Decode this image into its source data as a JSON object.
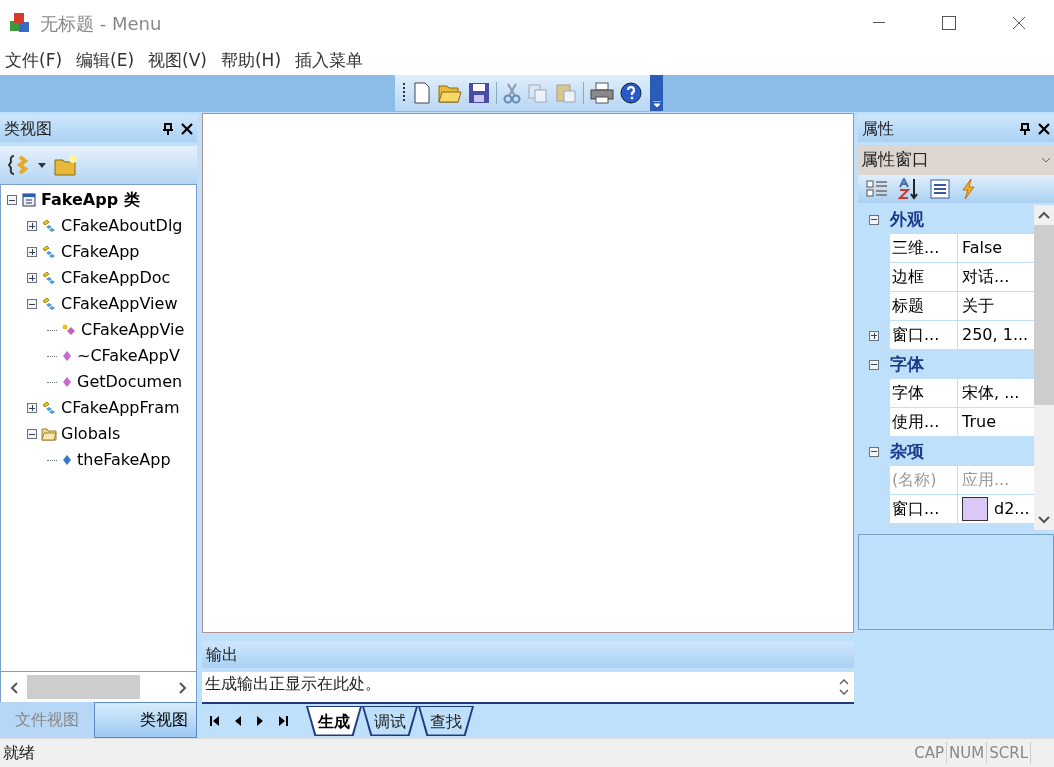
{
  "window": {
    "title": "无标题 - Menu"
  },
  "menu": [
    "文件(F)",
    "编辑(E)",
    "视图(V)",
    "帮助(H)",
    "插入菜单"
  ],
  "class_view": {
    "title": "类视图",
    "tree": [
      {
        "label": "FakeApp 类",
        "kind": "project",
        "expanded": true,
        "children": [
          {
            "label": "CFakeAboutDlg",
            "kind": "class",
            "expanded": false
          },
          {
            "label": "CFakeApp",
            "kind": "class",
            "expanded": false
          },
          {
            "label": "CFakeAppDoc",
            "kind": "class",
            "expanded": false
          },
          {
            "label": "CFakeAppView",
            "kind": "class",
            "expanded": true,
            "children": [
              {
                "label": "CFakeAppVie",
                "kind": "protected-method"
              },
              {
                "label": "~CFakeAppV",
                "kind": "method"
              },
              {
                "label": "GetDocumen",
                "kind": "method"
              }
            ]
          },
          {
            "label": "CFakeAppFram",
            "kind": "class",
            "expanded": false
          },
          {
            "label": "Globals",
            "kind": "folder",
            "expanded": true,
            "children": [
              {
                "label": "theFakeApp",
                "kind": "variable"
              }
            ]
          }
        ]
      }
    ],
    "tabs": [
      {
        "label": "文件视图",
        "selected": false
      },
      {
        "label": "类视图",
        "selected": true
      }
    ]
  },
  "output": {
    "title": "输出",
    "lines": [
      "生成输出正显示在此处。"
    ],
    "tabs": [
      {
        "label": "生成",
        "selected": true
      },
      {
        "label": "调试",
        "selected": false
      },
      {
        "label": "查找",
        "selected": false
      }
    ]
  },
  "properties": {
    "title": "属性",
    "combo": "属性窗口",
    "categories": [
      {
        "name": "外观",
        "expanded": true,
        "rows": [
          {
            "name": "三维...",
            "value": "False",
            "disabled": false
          },
          {
            "name": "边框",
            "value": "对话...",
            "disabled": false
          },
          {
            "name": "标题",
            "value": "关于",
            "disabled": false
          },
          {
            "name": "窗口...",
            "value": "250, 1...",
            "disabled": false,
            "expandable": true
          }
        ]
      },
      {
        "name": "字体",
        "expanded": true,
        "rows": [
          {
            "name": "字体",
            "value": "宋体, ...",
            "disabled": false
          },
          {
            "name": "使用...",
            "value": "True",
            "disabled": false
          }
        ]
      },
      {
        "name": "杂项",
        "expanded": true,
        "rows": [
          {
            "name": "(名称)",
            "value": "应用...",
            "disabled": true
          },
          {
            "name": "窗口...",
            "value": "d2...",
            "disabled": false,
            "color": "#dcc8f4"
          }
        ]
      }
    ]
  },
  "status_bar": {
    "text": "就绪",
    "indicators": [
      "CAP",
      "NUM",
      "SCRL"
    ]
  }
}
